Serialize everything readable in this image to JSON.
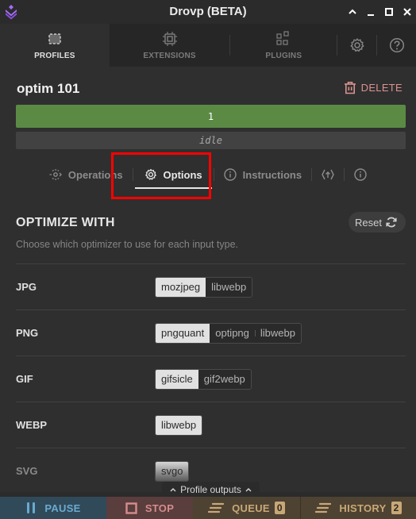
{
  "window": {
    "title": "Drovp (BETA)",
    "controls": [
      "collapse",
      "minimize",
      "maximize",
      "close"
    ]
  },
  "main_tabs": [
    {
      "label": "PROFILES",
      "icon": "profiles-icon",
      "active": true
    },
    {
      "label": "EXTENSIONS",
      "icon": "chip-icon",
      "active": false
    },
    {
      "label": "PLUGINS",
      "icon": "plugins-icon",
      "active": false
    }
  ],
  "main_tab_icons": [
    "gear-icon",
    "help-icon"
  ],
  "profile": {
    "name": "optim 101",
    "delete_label": "DELETE",
    "progress_value": "1",
    "progress_fraction": 1.0,
    "status": "idle"
  },
  "sub_tabs": [
    {
      "label": "Operations",
      "icon": "operations-icon",
      "active": false
    },
    {
      "label": "Options",
      "icon": "gear-icon",
      "active": true
    },
    {
      "label": "Instructions",
      "icon": "info-icon",
      "active": false
    },
    {
      "label": "",
      "icon": "export-icon",
      "active": false
    },
    {
      "label": "",
      "icon": "info-icon",
      "active": false
    }
  ],
  "options": {
    "title": "OPTIMIZE WITH",
    "description": "Choose which optimizer to use for each input type.",
    "reset_label": "Reset",
    "rows": [
      {
        "label": "JPG",
        "options": [
          "mozjpeg",
          "libwebp"
        ],
        "selected": "mozjpeg"
      },
      {
        "label": "PNG",
        "options": [
          "pngquant",
          "optipng",
          "libwebp"
        ],
        "selected": "pngquant"
      },
      {
        "label": "GIF",
        "options": [
          "gifsicle",
          "gif2webp"
        ],
        "selected": "gifsicle"
      },
      {
        "label": "WEBP",
        "options": [
          "libwebp"
        ],
        "selected": "libwebp"
      },
      {
        "label": "SVG",
        "options": [
          "svgo"
        ],
        "selected": "svgo"
      }
    ]
  },
  "outputs_tab": {
    "label": "Profile outputs"
  },
  "bottom_bar": {
    "pause": {
      "label": "PAUSE",
      "color": "#6aaad0"
    },
    "stop": {
      "label": "STOP",
      "color": "#d58c8c"
    },
    "queue": {
      "label": "QUEUE",
      "count": "0",
      "color": "#c8a877"
    },
    "history": {
      "label": "HISTORY",
      "count": "2",
      "color": "#c8a877"
    }
  },
  "colors": {
    "accent_purple": "#a66bff",
    "progress_green": "#5b8a45",
    "delete_red": "#d9928f",
    "highlight_red": "#ff0000"
  }
}
